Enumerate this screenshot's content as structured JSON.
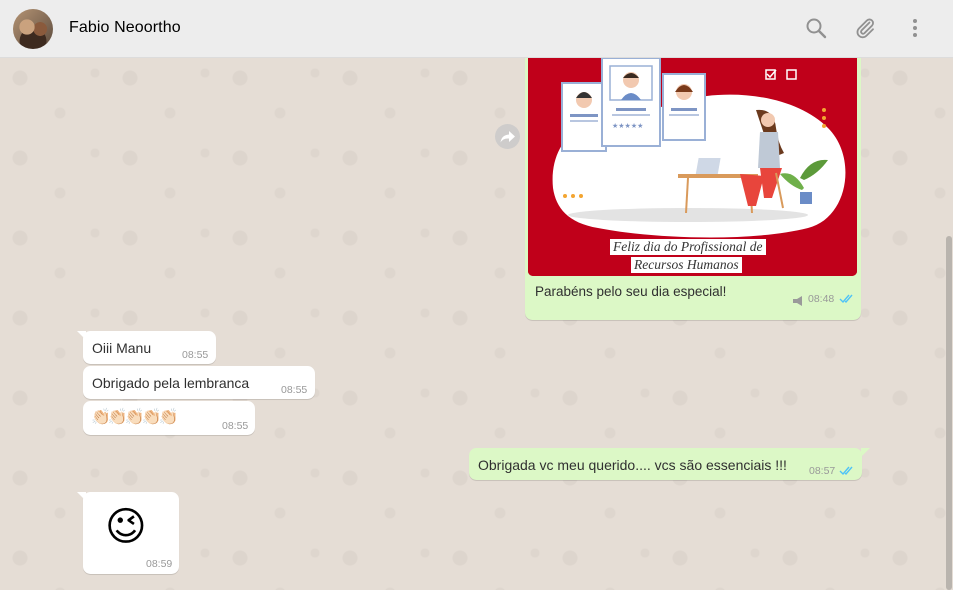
{
  "header": {
    "contact_name": "Fabio Neoortho",
    "icons": [
      "search-icon",
      "attach-icon",
      "menu-icon"
    ]
  },
  "image_message": {
    "image_caption_line1": "Feliz dia do Profissional de",
    "image_caption_line2": "Recursos Humanos",
    "text": "Parabéns pelo seu dia especial!",
    "time": "08:48",
    "status": "read"
  },
  "messages": [
    {
      "direction": "in",
      "text": "Oiii Manu",
      "time": "08:55"
    },
    {
      "direction": "in",
      "text": "Obrigado pela lembranca",
      "time": "08:55"
    },
    {
      "direction": "in",
      "text": "👏🏻👏🏻👏🏻👏🏻👏🏻",
      "time": "08:55"
    },
    {
      "direction": "out",
      "text": "Obrigada vc meu querido.... vcs são essenciais !!!",
      "time": "08:57",
      "status": "read"
    },
    {
      "direction": "in",
      "text": "😉",
      "time": "08:59"
    }
  ],
  "colors": {
    "header_bg": "#ededed",
    "chat_bg": "#e5ddd5",
    "outgoing_bubble": "#dcf8c6",
    "incoming_bubble": "#ffffff",
    "read_tick": "#4fc3f7",
    "image_bg": "#c0001a"
  }
}
